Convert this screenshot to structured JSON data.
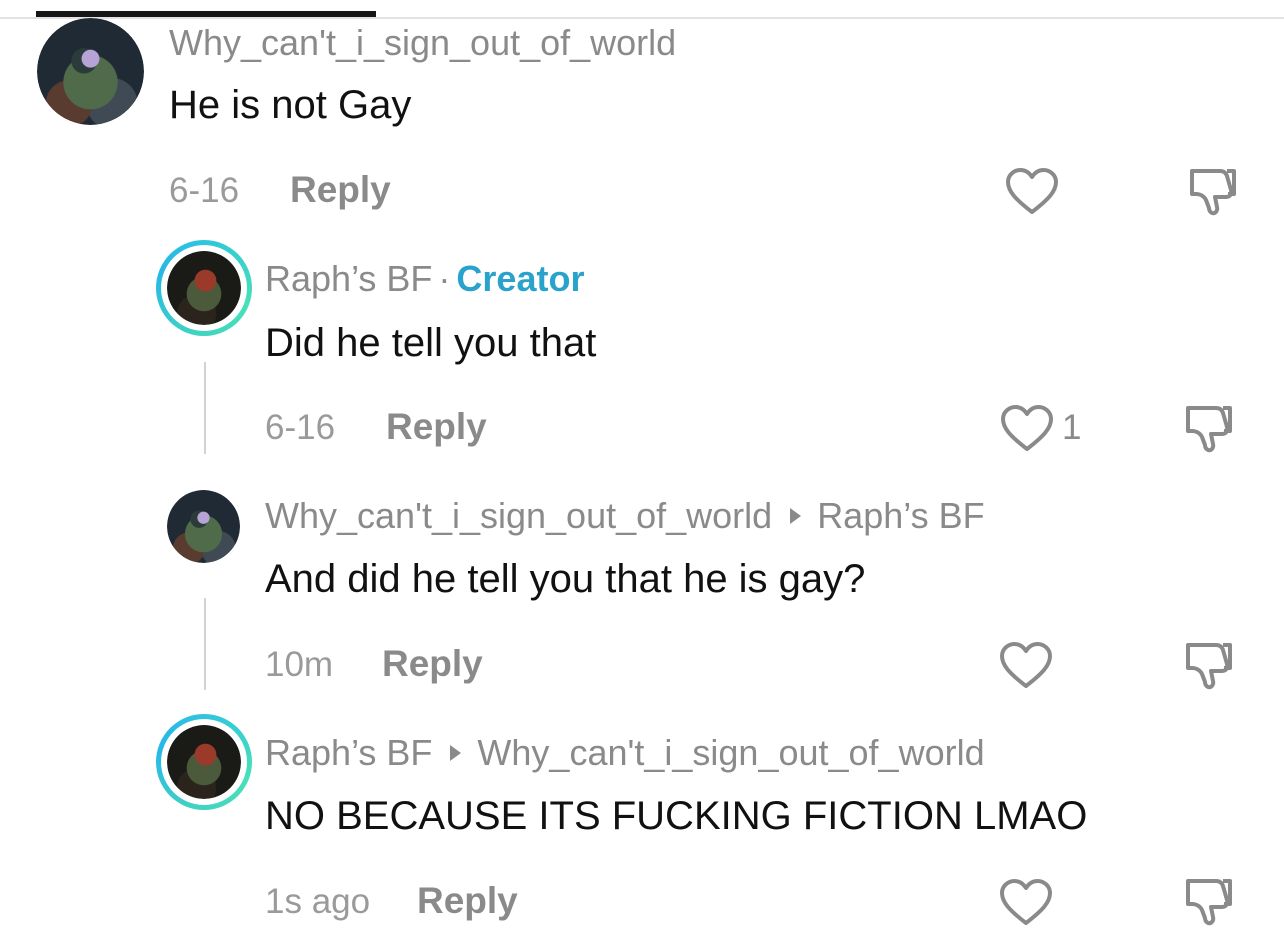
{
  "comments": [
    {
      "username": "Why_can't_i_sign_out_of_world",
      "text": "He is not Gay",
      "time": "6-16",
      "reply_label": "Reply",
      "likes": ""
    },
    {
      "username": "Raph’s BF",
      "separator": "·",
      "badge": "Creator",
      "text": "Did he tell you that",
      "time": "6-16",
      "reply_label": "Reply",
      "likes": "1"
    },
    {
      "username": "Why_can't_i_sign_out_of_world",
      "reply_to": "Raph’s BF",
      "text": "And did he tell you that he is gay?",
      "time": "10m",
      "reply_label": "Reply",
      "likes": ""
    },
    {
      "username": "Raph’s BF",
      "reply_to": "Why_can't_i_sign_out_of_world",
      "text": "NO BECAUSE ITS FUCKING FICTION LMAO",
      "time": "1s ago",
      "reply_label": "Reply",
      "likes": ""
    }
  ],
  "icons": {
    "like": "heart-outline-icon",
    "dislike": "thumbs-down-outline-icon",
    "reply_arrow": "triangle-right-icon"
  },
  "colors": {
    "creator_badge": "#2aa3cc",
    "story_ring_start": "#3fd1c4",
    "story_ring_end": "#27b7e8",
    "muted_text": "#8a8a8a"
  }
}
